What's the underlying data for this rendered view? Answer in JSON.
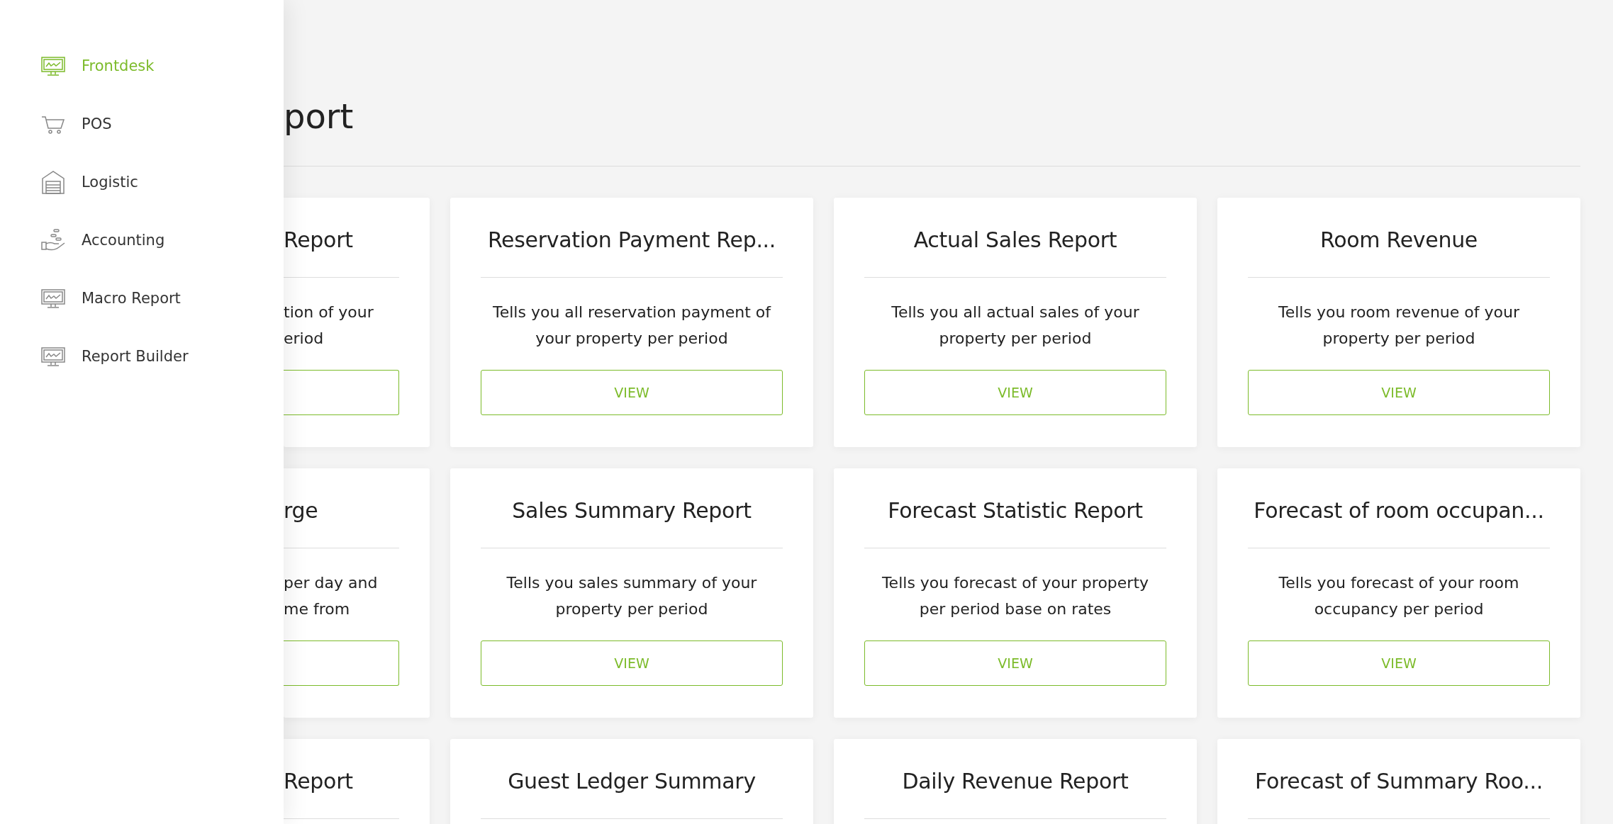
{
  "sidebar": {
    "items": [
      {
        "label": "Frontdesk",
        "kind": "monitor",
        "selected": true
      },
      {
        "label": "POS",
        "kind": "cart",
        "selected": false
      },
      {
        "label": "Logistic",
        "kind": "warehouse",
        "selected": false
      },
      {
        "label": "Accounting",
        "kind": "hand",
        "selected": false
      },
      {
        "label": "Macro Report",
        "kind": "monitor",
        "selected": false
      },
      {
        "label": "Report Builder",
        "kind": "monitor",
        "selected": false
      }
    ]
  },
  "page_title": "port",
  "cards": [
    {
      "kind": "cut",
      "title": "Report",
      "description_lines": [
        "tion of your",
        "eriod"
      ]
    },
    {
      "kind": "full",
      "title": "Reservation Payment Rep...",
      "description": "Tells you all reservation payment of your property per period",
      "button": "VIEW"
    },
    {
      "kind": "full",
      "title": "Actual Sales Report",
      "description": "Tells you all actual sales of your property per period",
      "button": "VIEW"
    },
    {
      "kind": "full",
      "title": "Room Revenue",
      "description": "Tells you room revenue of your property per period",
      "button": "VIEW"
    },
    {
      "kind": "cut",
      "title": "rge",
      "description_lines": [
        "per day and",
        "me from"
      ]
    },
    {
      "kind": "full",
      "title": "Sales Summary Report",
      "description": "Tells you sales summary of your property per period",
      "button": "VIEW"
    },
    {
      "kind": "full",
      "title": "Forecast Statistic Report",
      "description": "Tells you forecast of your property per period base on rates",
      "button": "VIEW"
    },
    {
      "kind": "full",
      "title": "Forecast of room occupan...",
      "description": "Tells you forecast of your room occupancy per period",
      "button": "VIEW"
    },
    {
      "kind": "cut",
      "title": "Report"
    },
    {
      "kind": "full",
      "title": "Guest Ledger Summary"
    },
    {
      "kind": "full",
      "title": "Daily Revenue Report"
    },
    {
      "kind": "full",
      "title": "Forecast of Summary Roo..."
    }
  ]
}
